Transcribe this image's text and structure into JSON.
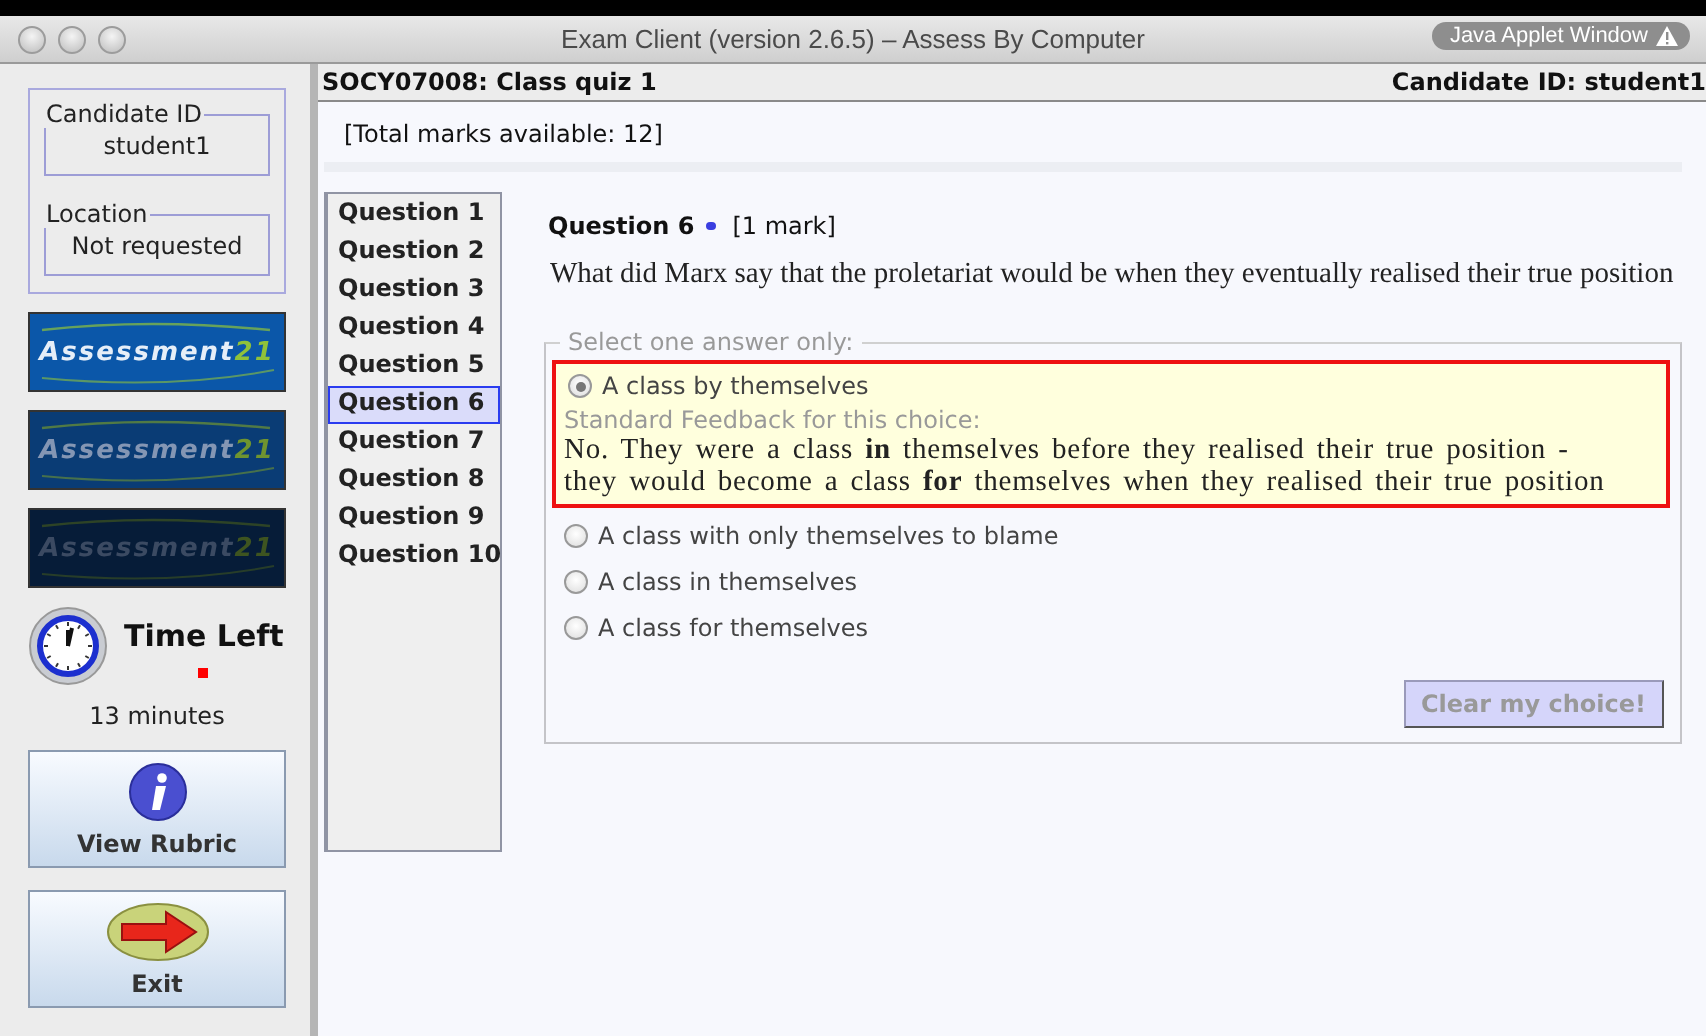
{
  "window": {
    "title": "Exam Client (version 2.6.5) – Assess By Computer",
    "badge": "Java Applet Window"
  },
  "sidebar": {
    "candidate": {
      "label": "Candidate ID",
      "value": "student1"
    },
    "location": {
      "label": "Location",
      "value": "Not requested"
    },
    "logos": [
      {
        "text": "Assessment",
        "suffix": "21",
        "kind": "bright"
      },
      {
        "text": "Assessment",
        "suffix": "21",
        "kind": "dim"
      },
      {
        "text": "Assessment",
        "suffix": "21",
        "kind": "dark"
      }
    ],
    "timer": {
      "label": "Time Left",
      "remaining": "13 minutes"
    },
    "buttons": [
      {
        "label": "View Rubric",
        "kind": "info"
      },
      {
        "label": "Exit",
        "kind": "exit"
      }
    ]
  },
  "header": {
    "course": "SOCY07008: Class quiz 1",
    "candidate": "Candidate ID: student1"
  },
  "total_marks": "[Total marks available: 12]",
  "questions": [
    {
      "label": "Question 1",
      "selected": false
    },
    {
      "label": "Question 2",
      "selected": false
    },
    {
      "label": "Question 3",
      "selected": false
    },
    {
      "label": "Question 4",
      "selected": false
    },
    {
      "label": "Question 5",
      "selected": false
    },
    {
      "label": "Question 6",
      "selected": true
    },
    {
      "label": "Question 7",
      "selected": false
    },
    {
      "label": "Question 8",
      "selected": false
    },
    {
      "label": "Question 9",
      "selected": false
    },
    {
      "label": "Question 10",
      "selected": false
    }
  ],
  "question": {
    "title": "Question 6",
    "flagged": true,
    "marks": "[1 mark]",
    "text": "What did Marx say that the proletariat would be when they eventually realised their true position",
    "instruction": "Select one answer only:",
    "options": [
      {
        "label": "A class by themselves",
        "selected": true,
        "feedback_label": "Standard Feedback for this choice:",
        "feedback": "No. They were a class **in** themselves before they realised their true position - they would become a class **for** themselves when they realised their true position"
      },
      {
        "label": "A class with only themselves to blame",
        "selected": false
      },
      {
        "label": "A class in themselves",
        "selected": false
      },
      {
        "label": "A class for themselves",
        "selected": false
      }
    ],
    "clear_button": {
      "label": "Clear my choice!",
      "disabled": true
    }
  }
}
